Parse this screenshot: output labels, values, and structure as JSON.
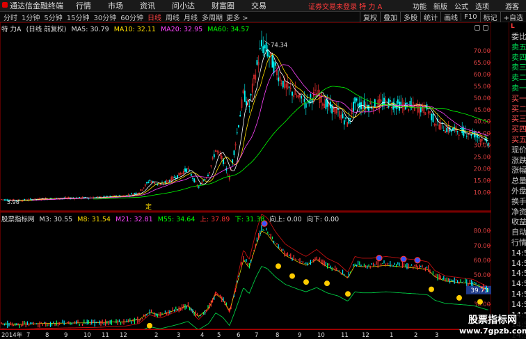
{
  "topbar": {
    "app_name": "通达信金融终端",
    "menus": [
      "行情",
      "市场",
      "资讯",
      "问小达",
      "财富圈",
      "交易"
    ],
    "warning": "证券交易未登录  特 力 A",
    "right_items": [
      "功能",
      "新版",
      "公式",
      "选项"
    ],
    "guest": "游客"
  },
  "toolbar": {
    "periods": [
      "分时",
      "1分钟",
      "5分钟",
      "15分钟",
      "30分钟",
      "60分钟",
      "日线",
      "周线",
      "月线",
      "多周期"
    ],
    "active_period": "日线",
    "more": "更多 >",
    "tools": [
      "复权",
      "叠加",
      "多股",
      "统计",
      "画线",
      "F10",
      "标记",
      "+自选"
    ]
  },
  "main_pane": {
    "stock": "特 力A",
    "mode": "(日线 前复权)",
    "ma5_label": "MA5: 30.79",
    "ma10_label": "MA10: 32.11",
    "ma20_label": "MA20: 32.95",
    "ma60_label": "MA60: 34.57",
    "high_label": "74.34",
    "low_label": "5.98",
    "ding_label": "定",
    "price_ticks": [
      "70.00",
      "65.00",
      "60.00",
      "55.00",
      "50.00",
      "45.00",
      "40.00",
      "35.00",
      "30.00",
      "25.00",
      "20.00",
      "15.00",
      "10.00"
    ]
  },
  "ind_pane": {
    "name": "股票指标网",
    "m3": "M3: 30.55",
    "m8": "M8: 31.54",
    "m21": "M21: 32.81",
    "m55": "M55: 34.64",
    "up": "上: 37.89",
    "down": "下: 31.38",
    "xiang_shang": "向上: 0.00",
    "xiang_xia": "向下: 0.00",
    "ticks": [
      "80.00",
      "70.00",
      "60.00",
      "50.00",
      "40.00",
      "30.00",
      "20.00"
    ],
    "current_value": "39.73"
  },
  "date_axis": {
    "year_label": "2014年",
    "months": [
      "7",
      "8",
      "9",
      "10",
      "11",
      "12",
      "2",
      "3",
      "4",
      "5",
      "6",
      "7",
      "8",
      "9",
      "10",
      "11",
      "12",
      "1",
      "2",
      "3"
    ]
  },
  "side_panel": {
    "logo": "L",
    "items": [
      "委比",
      "卖五",
      "卖四",
      "卖三",
      "卖二",
      "卖一",
      "买一",
      "买二",
      "买三",
      "买四",
      "买五",
      "现价",
      "涨跌",
      "涨幅",
      "总量",
      "外盘",
      "换手",
      "净资",
      "收益",
      "自动",
      "行情"
    ],
    "times": [
      "14:5",
      "14:5",
      "14:5",
      "14:5",
      "14:5",
      "14:5",
      "14:5",
      "14:5",
      "14:5",
      "14:5"
    ]
  },
  "watermark": {
    "line1": "股票指标网",
    "line2": "www.7gpzb.com"
  },
  "colors": {
    "ma5": "#ffffff",
    "ma10": "#ffdd00",
    "ma20": "#ff44ff",
    "ma60": "#00ff00",
    "up_candle": "#ff3333",
    "down_candle": "#00ffff",
    "frame": "#aa0000"
  }
}
